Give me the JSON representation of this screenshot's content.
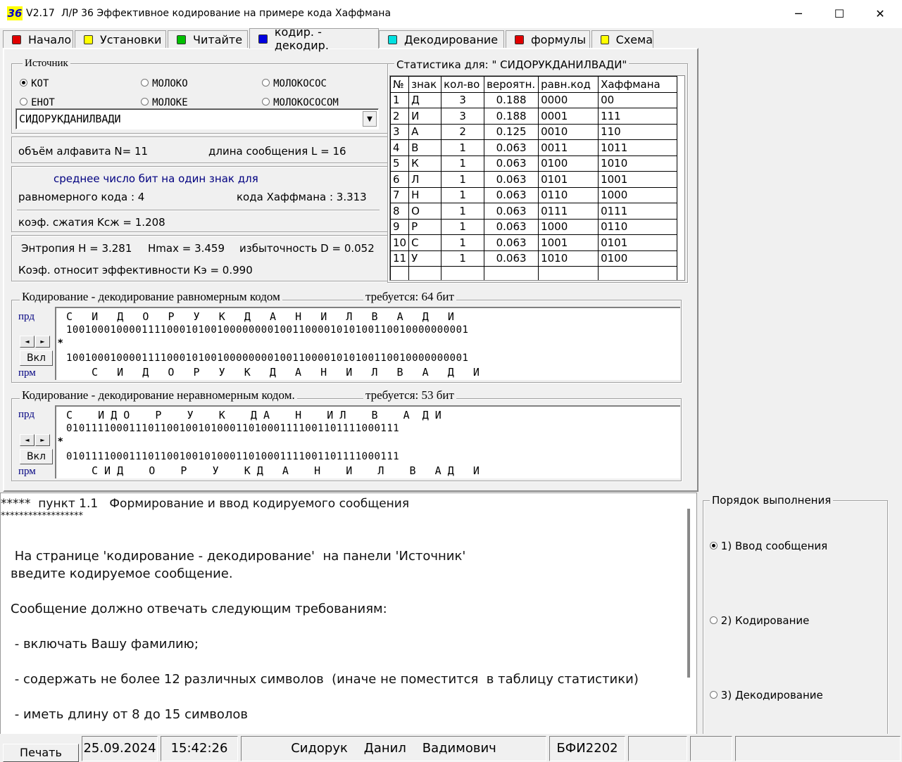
{
  "window": {
    "icon_text": "36",
    "version": "V2.17",
    "title": "Л/Р 36  Эффективное кодирование на примере кода Хаффмана",
    "minimize": "─",
    "maximize": "☐",
    "close": "✕"
  },
  "tabs": [
    {
      "label": "Начало",
      "color": "#e00000"
    },
    {
      "label": "Установки",
      "color": "#ffff00"
    },
    {
      "label": "Читайте",
      "color": "#00c000"
    },
    {
      "label": "кодир. - декодир.",
      "color": "#0000e0"
    },
    {
      "label": "Декодирование",
      "color": "#00e0e0"
    },
    {
      "label": "формулы",
      "color": "#e00000"
    },
    {
      "label": "Схема",
      "color": "#ffff00"
    }
  ],
  "source": {
    "title": "Источник",
    "options": [
      "КОТ",
      "МОЛОКО",
      "МОЛОКОСОС",
      "ЕНОТ",
      "МОЛОКЕ",
      "МОЛОКОСОСОМ"
    ],
    "selected": "КОТ",
    "message_value": "СИДОРУКДАНИЛВАДИ",
    "dropdown_arrow": "▼"
  },
  "info": {
    "alphabet": "объём алфавита N=  11",
    "msg_length": "длина сообщения L =  16",
    "avg_bits_title": "среднее число бит на один знак для",
    "uniform": "равномерного кода :  4",
    "huffman": "кода Хаффмана : 3.313",
    "compression": "коэф.  сжатия  Kсж = 1.208",
    "entropy": "Энтропия Н = 3.281",
    "hmax": "Hmax = 3.459",
    "redundancy": "избыточность D = 0.052",
    "efficiency": "Коэф. относит эффективности  Кэ = 0.990"
  },
  "stats": {
    "title": "Статистика для: \"  СИДОРУКДАНИЛВАДИ\"",
    "headers": [
      "№",
      "знак",
      "кол-во",
      "вероятн.",
      "равн.код",
      "Хаффмана"
    ],
    "rows": [
      [
        "1",
        "Д",
        "3",
        "0.188",
        "0000",
        "00"
      ],
      [
        "2",
        "И",
        "3",
        "0.188",
        "0001",
        "111"
      ],
      [
        "3",
        "А",
        "2",
        "0.125",
        "0010",
        "110"
      ],
      [
        "4",
        "В",
        "1",
        "0.063",
        "0011",
        "1011"
      ],
      [
        "5",
        "К",
        "1",
        "0.063",
        "0100",
        "1010"
      ],
      [
        "6",
        "Л",
        "1",
        "0.063",
        "0101",
        "1001"
      ],
      [
        "7",
        "Н",
        "1",
        "0.063",
        "0110",
        "1000"
      ],
      [
        "8",
        "О",
        "1",
        "0.063",
        "0111",
        "0111"
      ],
      [
        "9",
        "Р",
        "1",
        "0.063",
        "1000",
        "0110"
      ],
      [
        "10",
        "С",
        "1",
        "0.063",
        "1001",
        "0101"
      ],
      [
        "11",
        "У",
        "1",
        "0.063",
        "1010",
        "0100"
      ],
      [
        "",
        "",
        "",
        "",
        "",
        ""
      ]
    ]
  },
  "uniform_coding": {
    "title": "Кодирование - декодирование равномерным кодом",
    "required": "требуется: 64 бит",
    "prd_label": "прд",
    "prm_label": "прм",
    "prd_text": "С   И   Д   О   Р   У   К   Д   А   Н   И   Л   В   А   Д   И",
    "prd_bits": "1001000100001111000101001000000001001100001010100110010000000001",
    "star": "*",
    "prm_bits": "1001000100001111000101001000000001001100001010100110010000000001",
    "prm_text": "С   И   Д   О   Р   У   К   Д   А   Н   И   Л   В   А   Д   И",
    "left": "◄",
    "right": "►",
    "vkl": "Вкл"
  },
  "huffman_coding": {
    "title": "Кодирование - декодирование неравномерным кодом.",
    "required": "требуется: 53 бит",
    "prd_label": "прд",
    "prm_label": "прм",
    "prd_text": "С    И Д О    Р    У    К    Д А    Н    И Л    В    А  Д И",
    "prd_bits": "01011110001110110010010100011010001111001101111000111",
    "star": "*",
    "prm_bits": "01011110001110110010010100011010001111001101111000111",
    "prm_text": "С И Д    О    Р    У    К Д   А    Н    И    Л    В   А Д   И",
    "left": "◄",
    "right": "►",
    "vkl": "Вкл"
  },
  "memo": {
    "lines": [
      "*****  пункт 1.1   Формирование и ввод кодируемого сообщения",
      "******************",
      "",
      " На странице 'кодирование - декодирование'  на панели 'Источник'",
      "введите кодируемое сообщение.",
      "",
      "Сообщение должно отвечать следующим требованиям:",
      "",
      " - включать Вашу фамилию;",
      "",
      " - содержать не более 12 различных символов  (иначе не поместится  в таблицу статистики)",
      "",
      " - иметь длину от 8 до 15 символов"
    ]
  },
  "order": {
    "title": "Порядок выполнения",
    "steps": [
      "1) Ввод сообщения",
      "2) Кодирование",
      "3) Декодирование"
    ],
    "selected": "1) Ввод сообщения"
  },
  "status": {
    "print": "Печать",
    "date": "25.09.2024",
    "time": "15:42:26",
    "surname": "Сидорук",
    "name": "Данил",
    "patronymic": "Вадимович",
    "group": "БФИ2202"
  }
}
